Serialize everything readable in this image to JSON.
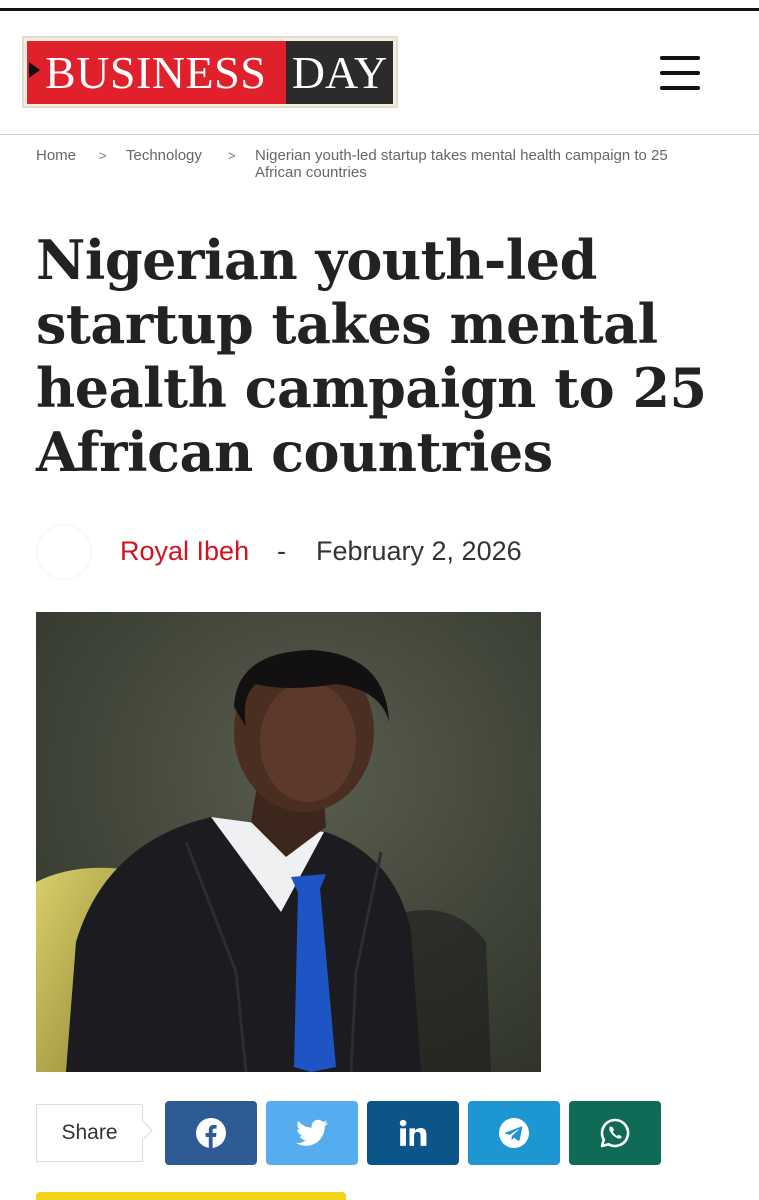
{
  "header": {
    "logo_left": "BUSINESS",
    "logo_right": "DAY",
    "logo_red": "#e0202a",
    "logo_dark": "#2b2b2b",
    "menu_icon": "hamburger-menu-icon"
  },
  "breadcrumb": {
    "items": [
      "Home",
      "Technology",
      "Nigerian youth-led startup takes mental health campaign to 25",
      "African countries"
    ],
    "separator": ">"
  },
  "article": {
    "title_lines": [
      "Nigerian youth-led",
      "startup takes mental",
      "health campaign to 25",
      "African countries"
    ],
    "author": "Royal Ibeh",
    "separator": "-",
    "date": "February 2, 2026",
    "author_color": "#d2131f"
  },
  "share": {
    "label": "Share",
    "buttons": [
      {
        "name": "facebook",
        "icon": "facebook-icon",
        "color": "#2e5a96"
      },
      {
        "name": "twitter",
        "icon": "twitter-icon",
        "color": "#55acee"
      },
      {
        "name": "linkedin",
        "icon": "linkedin-icon",
        "color": "#0c5588"
      },
      {
        "name": "telegram",
        "icon": "telegram-icon",
        "color": "#1e96d1"
      },
      {
        "name": "whatsapp",
        "icon": "whatsapp-icon",
        "color": "#0f6a57"
      }
    ]
  }
}
